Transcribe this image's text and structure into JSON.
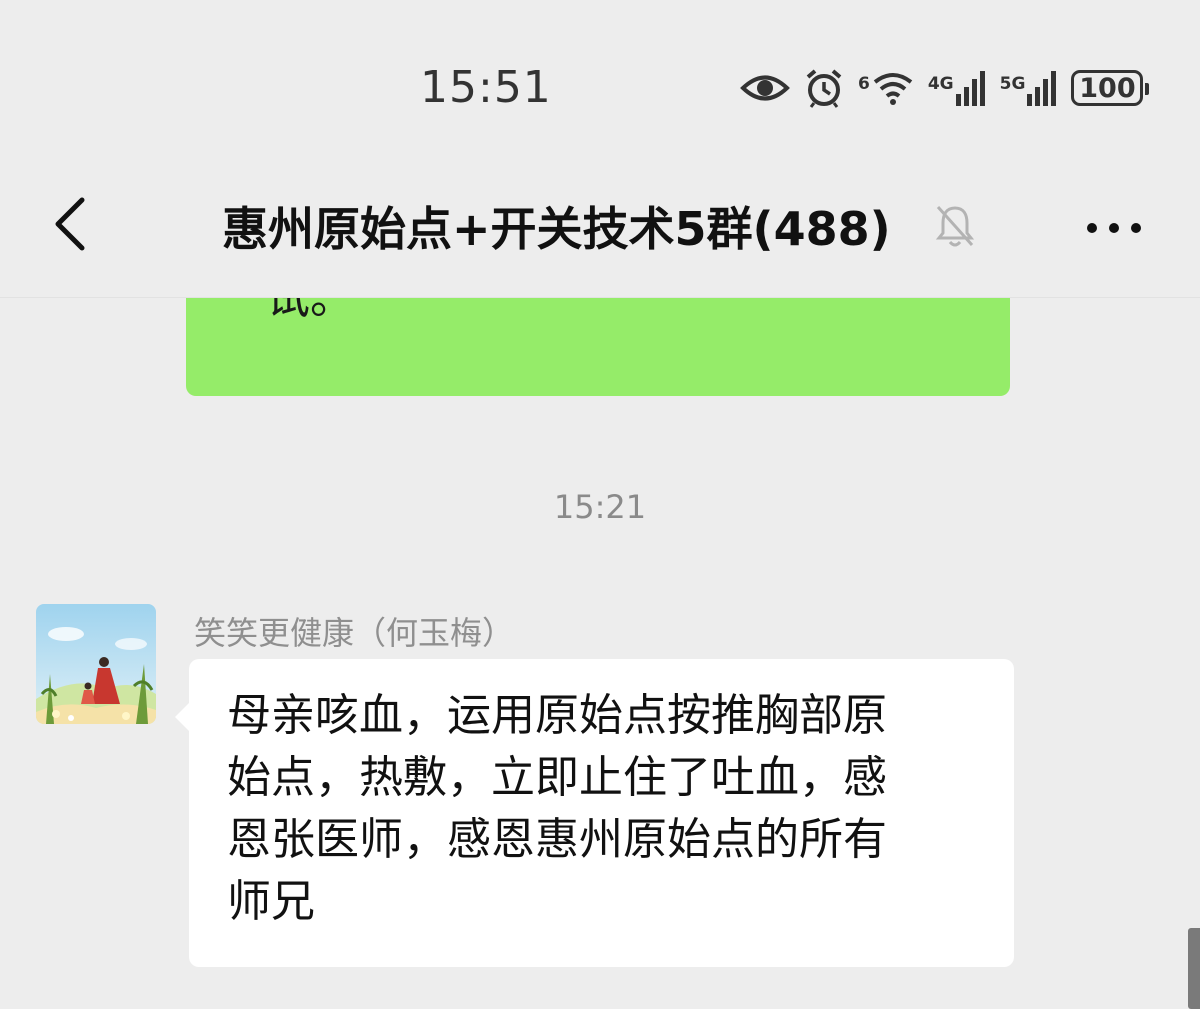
{
  "status_bar": {
    "time": "15:51",
    "wifi_tag": "6",
    "net1_tag": "4G",
    "net2_tag": "5G",
    "battery": "100",
    "icons": [
      "eye-icon",
      "alarm-icon",
      "wifi-icon",
      "signal-4g-icon",
      "signal-5g-icon",
      "battery-icon"
    ]
  },
  "header": {
    "title": "惠州原始点+开关技术5群(488)",
    "icons": [
      "back-chevron-icon",
      "mute-bell-icon",
      "more-dots-icon"
    ]
  },
  "messages": {
    "outgoing_partial": {
      "visible_line": "一试。"
    },
    "timestamp": "15:21",
    "incoming": {
      "sender": "笑笑更健康（何玉梅）",
      "lines": [
        "母亲咳血，运用原始点按推胸部原",
        "始点，热敷，立即止住了吐血，感",
        "恩张医师，感恩惠州原始点的所有",
        "师兄"
      ]
    }
  },
  "colors": {
    "background": "#ededed",
    "outgoing_bubble": "#95ec69",
    "incoming_bubble": "#ffffff"
  }
}
